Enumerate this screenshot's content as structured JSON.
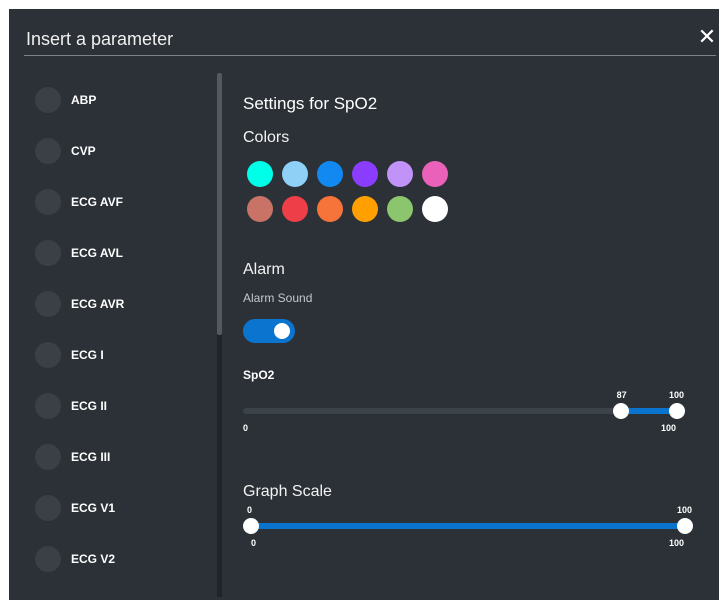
{
  "dialog": {
    "title": "Insert a parameter",
    "close_icon": "close-icon",
    "close_glyph": "✕"
  },
  "parameters": [
    "ABP",
    "CVP",
    "ECG AVF",
    "ECG AVL",
    "ECG AVR",
    "ECG I",
    "ECG II",
    "ECG III",
    "ECG V1",
    "ECG V2"
  ],
  "settings": {
    "title": "Settings for SpO2",
    "colors_title": "Colors",
    "colors": [
      [
        "#00ffe8",
        "#8fd0f6",
        "#1289f0",
        "#8a3dff",
        "#c193f8",
        "#e961b8"
      ],
      [
        "#c87366",
        "#ee3e48",
        "#f6733a",
        "#ffa000",
        "#8bc56d",
        "#ffffff"
      ]
    ],
    "alarm_title": "Alarm",
    "alarm_sound_label": "Alarm Sound",
    "alarm_sound_on": true,
    "spo2_slider": {
      "label": "SpO2",
      "min": 0,
      "max": 100,
      "low": 87,
      "high": 100,
      "min_label": "0",
      "max_label": "100",
      "low_label": "87",
      "high_label": "100"
    },
    "graph_scale": {
      "title": "Graph Scale",
      "min": 0,
      "max": 100,
      "low": 0,
      "high": 100,
      "min_label": "0",
      "max_label": "100",
      "low_label": "0",
      "high_label": "100"
    }
  },
  "theme": {
    "accent": "#0b74cf",
    "background": "#2b3136",
    "inactive_track": "#3d4449"
  }
}
